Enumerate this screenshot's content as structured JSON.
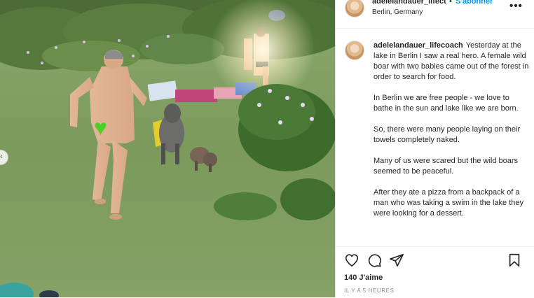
{
  "post": {
    "username": "adelelandauer_lifect",
    "separator": "•",
    "follow_label": "S'abonner",
    "location": "Berlin, Germany",
    "more_icon": "ellipsis-icon",
    "caption_username": "adelelandauer_lifecoach",
    "caption_paragraphs": [
      "Yesterday at the lake in Berlin I saw a real hero. A female wild boar with two babies came out of the forest in order to search for food.",
      "In Berlin we are free people - we love to bathe in the sun and lake like we are born.",
      "So, there were many people laying on their towels completely naked.",
      "Many of us were scared but the wild boars seemed to be peaceful.",
      "After they ate a pizza from a backpack of a man who was taking a swim in the lake they were looking for a dessert."
    ],
    "likes": "140 J'aime",
    "time_ago": "IL Y A 5 HEURES"
  },
  "icons": {
    "like": "heart-icon",
    "comment": "comment-icon",
    "share": "send-icon",
    "save": "bookmark-icon",
    "censor": "green-heart-icon",
    "nav": "chevron-left-icon"
  },
  "colors": {
    "follow": "#0095f6",
    "text": "#262626",
    "muted": "#8e8e8e",
    "censor_heart": "#4ccf2a"
  }
}
